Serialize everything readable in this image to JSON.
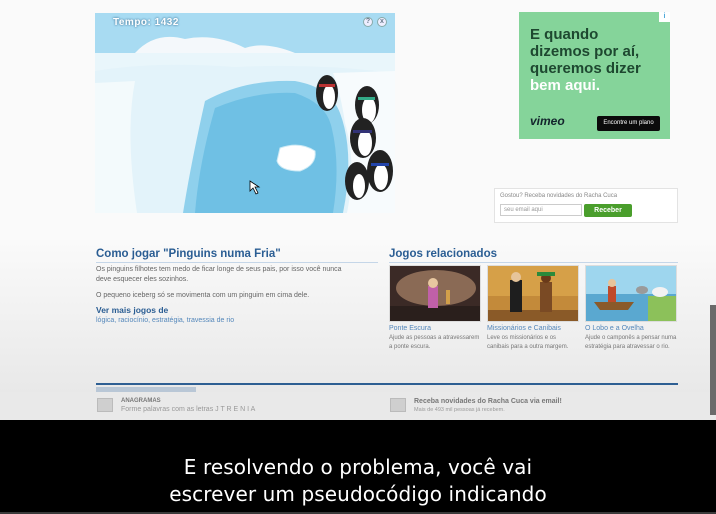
{
  "game": {
    "timer": "Tempo: 1432",
    "help_label": "?",
    "close_label": "x"
  },
  "ad": {
    "line1": "E quando",
    "line2": "dizemos por aí,",
    "line3": "queremos dizer",
    "line4": "bem aqui.",
    "logo": "vimeo",
    "button": "Encontre um plano",
    "choice_label": "i"
  },
  "newsletter": {
    "label": "Gostou? Receba novidades do Racha Cuca",
    "placeholder": "seu email aqui",
    "button": "Receber"
  },
  "howto": {
    "title": "Como jogar \"Pinguins numa Fria\"",
    "p1_line1": "Os pinguins filhotes tem medo de ficar longe de seus pais, por isso você nunca",
    "p1_line2": "deve esquecer eles sozinhos.",
    "p2": "O pequeno iceberg só se movimenta com um pinguim em cima dele.",
    "more_title": "Ver mais jogos de",
    "tags": [
      "lógica",
      "raciocínio",
      "estratégia",
      "travessia de rio"
    ]
  },
  "related": {
    "title": "Jogos relacionados",
    "items": [
      {
        "name": "Ponte Escura",
        "desc": "Ajude as pessoas a atravessarem a ponte escura."
      },
      {
        "name": "Missionários e Canibais",
        "desc": "Leve os missionários e os canibais para a outra margem."
      },
      {
        "name": "O Lobo e a Ovelha",
        "desc": "Ajude o camponês a pensar numa estratégia para atravessar o rio."
      }
    ]
  },
  "bottom_bar": {
    "left_title": "ANAGRAMAS",
    "left_text": "Forme palavras com as letras J T R E N I A",
    "right_title": "Receba novidades do Racha Cuca via email!",
    "right_text": "Mais de 493 mil pessoas já recebem."
  },
  "subtitles": {
    "line1": "E resolvendo o problema, você vai",
    "line2": "escrever um pseudocódigo indicando"
  }
}
